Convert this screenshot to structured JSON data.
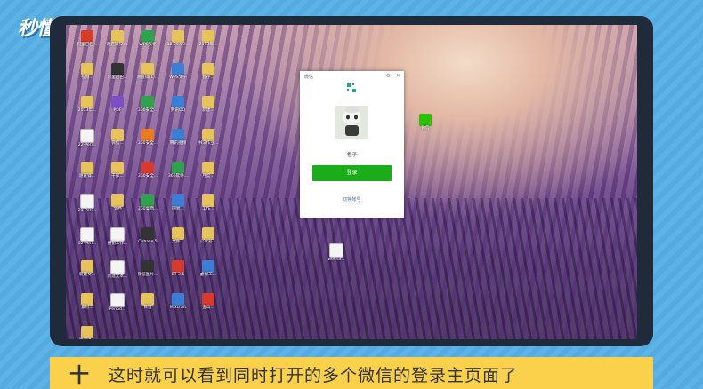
{
  "brand": {
    "logo_text": "秒懂视频"
  },
  "desktop": {
    "icons": [
      {
        "id": "i1",
        "label": "阿里巴巴...",
        "glyph": "g-red"
      },
      {
        "id": "i2",
        "label": "谢霆锋(2)...",
        "glyph": "g-folder"
      },
      {
        "id": "i3",
        "label": "WPS表格",
        "glyph": "g-green"
      },
      {
        "id": "i4",
        "label": "10.09.09...",
        "glyph": "g-folder"
      },
      {
        "id": "i5",
        "label": "2013年...",
        "glyph": "g-folder"
      },
      {
        "id": "i6",
        "label": "视频...",
        "glyph": "g-folder"
      },
      {
        "id": "i7",
        "label": "阿里巴巴...",
        "glyph": "g-dark"
      },
      {
        "id": "i8",
        "label": "谢霆锋(1)...",
        "glyph": "g-folder"
      },
      {
        "id": "i9",
        "label": "WPS文字",
        "glyph": "g-app"
      },
      {
        "id": "i10",
        "label": "暂存...",
        "glyph": "g-folder"
      },
      {
        "id": "i11",
        "label": "2013年...",
        "glyph": "g-folder"
      },
      {
        "id": "i12",
        "label": "PDF",
        "glyph": "g-purple"
      },
      {
        "id": "i13",
        "label": "360安全...",
        "glyph": "g-green"
      },
      {
        "id": "i14",
        "label": "腾讯QQ",
        "glyph": "g-app"
      },
      {
        "id": "i15",
        "label": "新建...",
        "glyph": "g-folder"
      },
      {
        "id": "i16",
        "label": "22-Peri...",
        "glyph": "g-doc"
      },
      {
        "id": "i17",
        "label": "微信...",
        "glyph": "g-folder"
      },
      {
        "id": "i18",
        "label": "360安全...",
        "glyph": "g-orange"
      },
      {
        "id": "i19",
        "label": "腾讯视频",
        "glyph": "g-app"
      },
      {
        "id": "i20",
        "label": "书法作业...",
        "glyph": "g-folder"
      },
      {
        "id": "i21",
        "label": "谢霆锋...",
        "glyph": "g-folder"
      },
      {
        "id": "i22",
        "label": "干部...",
        "glyph": "g-folder"
      },
      {
        "id": "i23",
        "label": "360安全...",
        "glyph": "g-red"
      },
      {
        "id": "i24",
        "label": "360软件...",
        "glyph": "g-green"
      },
      {
        "id": "i25",
        "label": "月度...",
        "glyph": "g-folder"
      },
      {
        "id": "i26",
        "label": "21-Peri...",
        "glyph": "g-doc"
      },
      {
        "id": "i27",
        "label": "文档",
        "glyph": "g-folder"
      },
      {
        "id": "i28",
        "label": "360桌面...",
        "glyph": "g-green"
      },
      {
        "id": "i29",
        "label": "网易...",
        "glyph": "g-app"
      },
      {
        "id": "i30",
        "label": "工作...",
        "glyph": "g-folder"
      },
      {
        "id": "i31",
        "label": "02-Peri...",
        "glyph": "g-doc"
      },
      {
        "id": "i32",
        "label": "报销工作...",
        "glyph": "g-doc"
      },
      {
        "id": "i33",
        "label": "Cubase 5",
        "glyph": "g-dark"
      },
      {
        "id": "i34",
        "label": "文件...",
        "glyph": "g-folder"
      },
      {
        "id": "i35",
        "label": "公众号...",
        "glyph": "g-folder"
      },
      {
        "id": "i36",
        "label": "新建文...",
        "glyph": "g-folder"
      },
      {
        "id": "i37",
        "label": "新建文本...",
        "glyph": "g-doc"
      },
      {
        "id": "i38",
        "label": "微信图片...",
        "glyph": "g-dark"
      },
      {
        "id": "i39",
        "label": "BT 3.5",
        "glyph": "g-red"
      },
      {
        "id": "i40",
        "label": "虚拟工...",
        "glyph": "g-app"
      },
      {
        "id": "i41",
        "label": "素材...",
        "glyph": "g-folder"
      },
      {
        "id": "i42",
        "label": "Period...",
        "glyph": "g-doc"
      },
      {
        "id": "i43",
        "label": "日程",
        "glyph": "g-folder"
      },
      {
        "id": "i44",
        "label": "Mixcraft",
        "glyph": "g-app"
      },
      {
        "id": "i45",
        "label": "金山...",
        "glyph": "g-red"
      },
      {
        "id": "i46",
        "label": "谢霆锋...",
        "glyph": "g-folder"
      },
      {
        "id": "i47",
        "label": "wecha...",
        "glyph": "g-doc"
      },
      {
        "id": "i48",
        "label": "微信",
        "glyph": "g-wechat"
      }
    ]
  },
  "wechat_window": {
    "title": "微信",
    "settings_icon": "gear-icon",
    "close_icon": "close-icon",
    "username": "橙子",
    "login_label": "登录",
    "switch_label": "切换帐号"
  },
  "caption": {
    "plus": "十",
    "text": "这时就可以看到同时打开的多个微信的登录主页面了"
  },
  "colors": {
    "background": "#5bb1e6",
    "caption_bg": "#fbd04a",
    "login_button": "#1aad19"
  }
}
